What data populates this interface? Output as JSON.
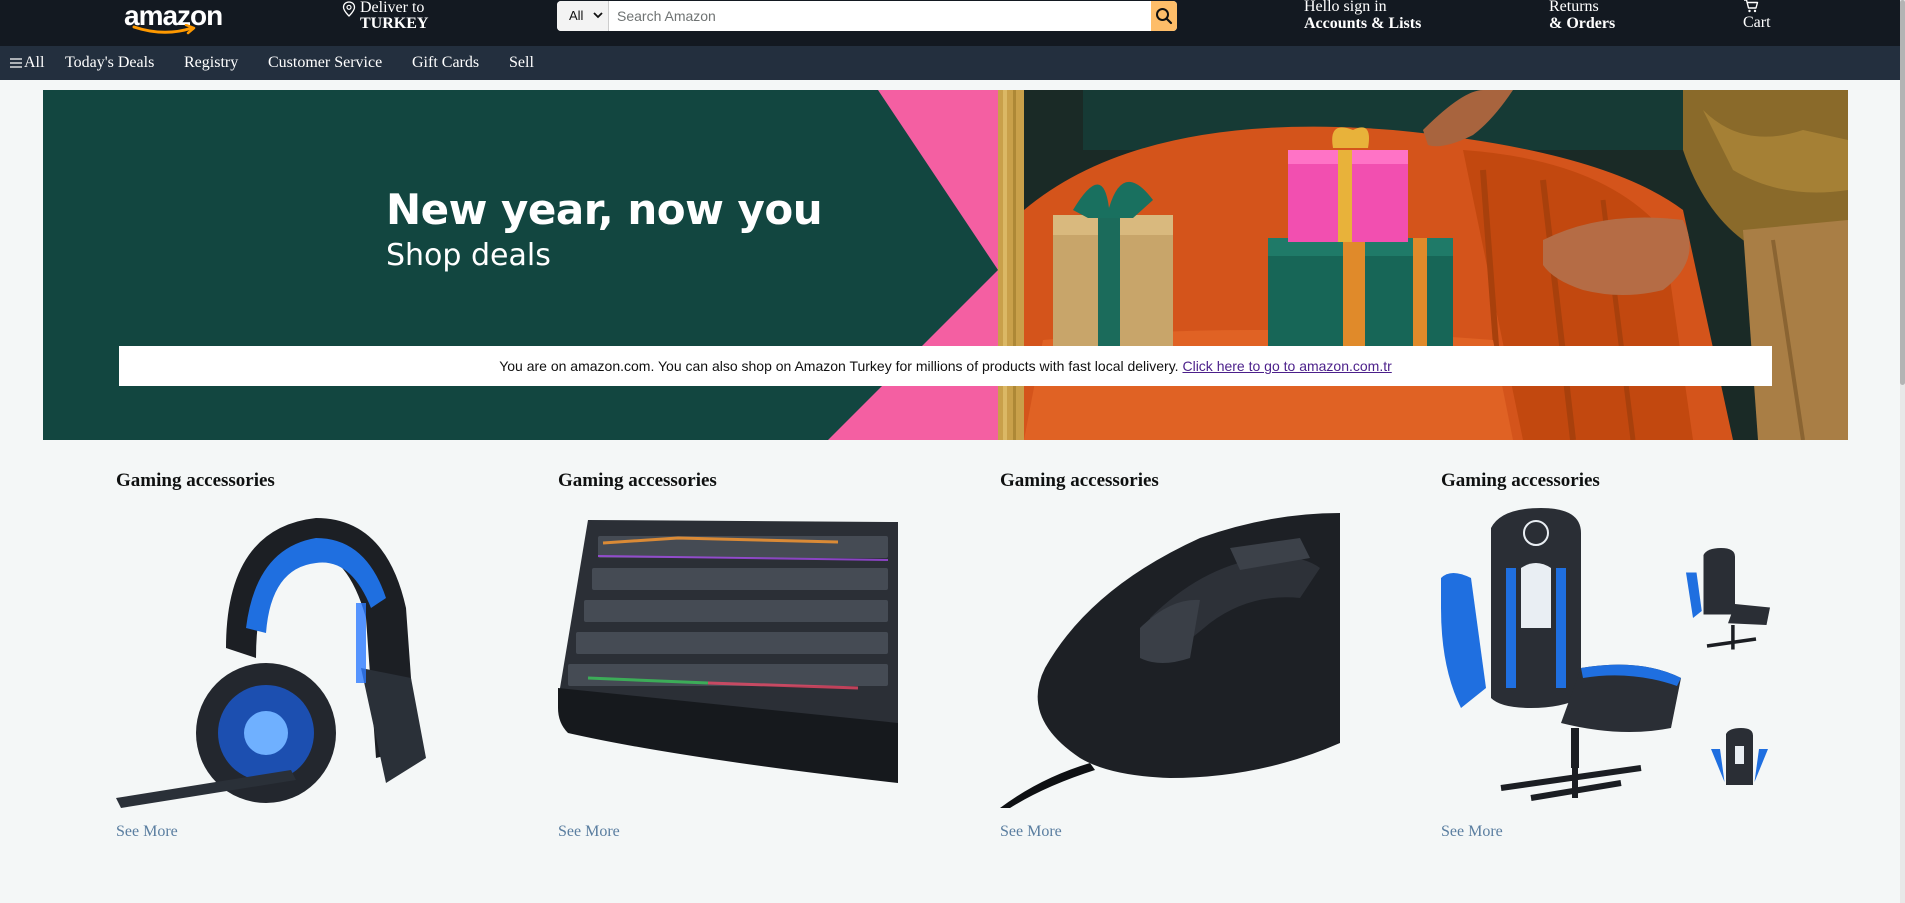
{
  "header": {
    "logo_text": "amazon",
    "deliver_line1": "Deliver to",
    "deliver_line2": "TURKEY",
    "search_category": "All",
    "search_placeholder": "Search Amazon",
    "account_line1": "Hello sign in",
    "account_line2": "Accounts & Lists",
    "orders_line1": "Returns",
    "orders_line2": "& Orders",
    "cart_label": "Cart"
  },
  "subnav": {
    "all_label": "All",
    "items": [
      "Today's Deals",
      "Registry",
      "Customer Service",
      "Gift Cards",
      "Sell"
    ]
  },
  "hero": {
    "headline": "New year, now you",
    "subheadline": "Shop deals",
    "notice_text": "You are on amazon.com. You can also shop on Amazon Turkey for millions of products with fast local delivery.",
    "notice_link": "Click here to go to amazon.com.tr"
  },
  "cards": [
    {
      "title": "Gaming accessories",
      "see_more": "See More",
      "image": "headset-icon"
    },
    {
      "title": "Gaming accessories",
      "see_more": "See More",
      "image": "keyboard-icon"
    },
    {
      "title": "Gaming accessories",
      "see_more": "See More",
      "image": "mouse-icon"
    },
    {
      "title": "Gaming accessories",
      "see_more": "See More",
      "image": "gaming-chair-icon"
    }
  ],
  "colors": {
    "nav_top": "#131921",
    "nav_sub": "#232f3e",
    "search_button": "#febd69",
    "hero_bg": "#124640",
    "link": "#4b1f8a"
  }
}
